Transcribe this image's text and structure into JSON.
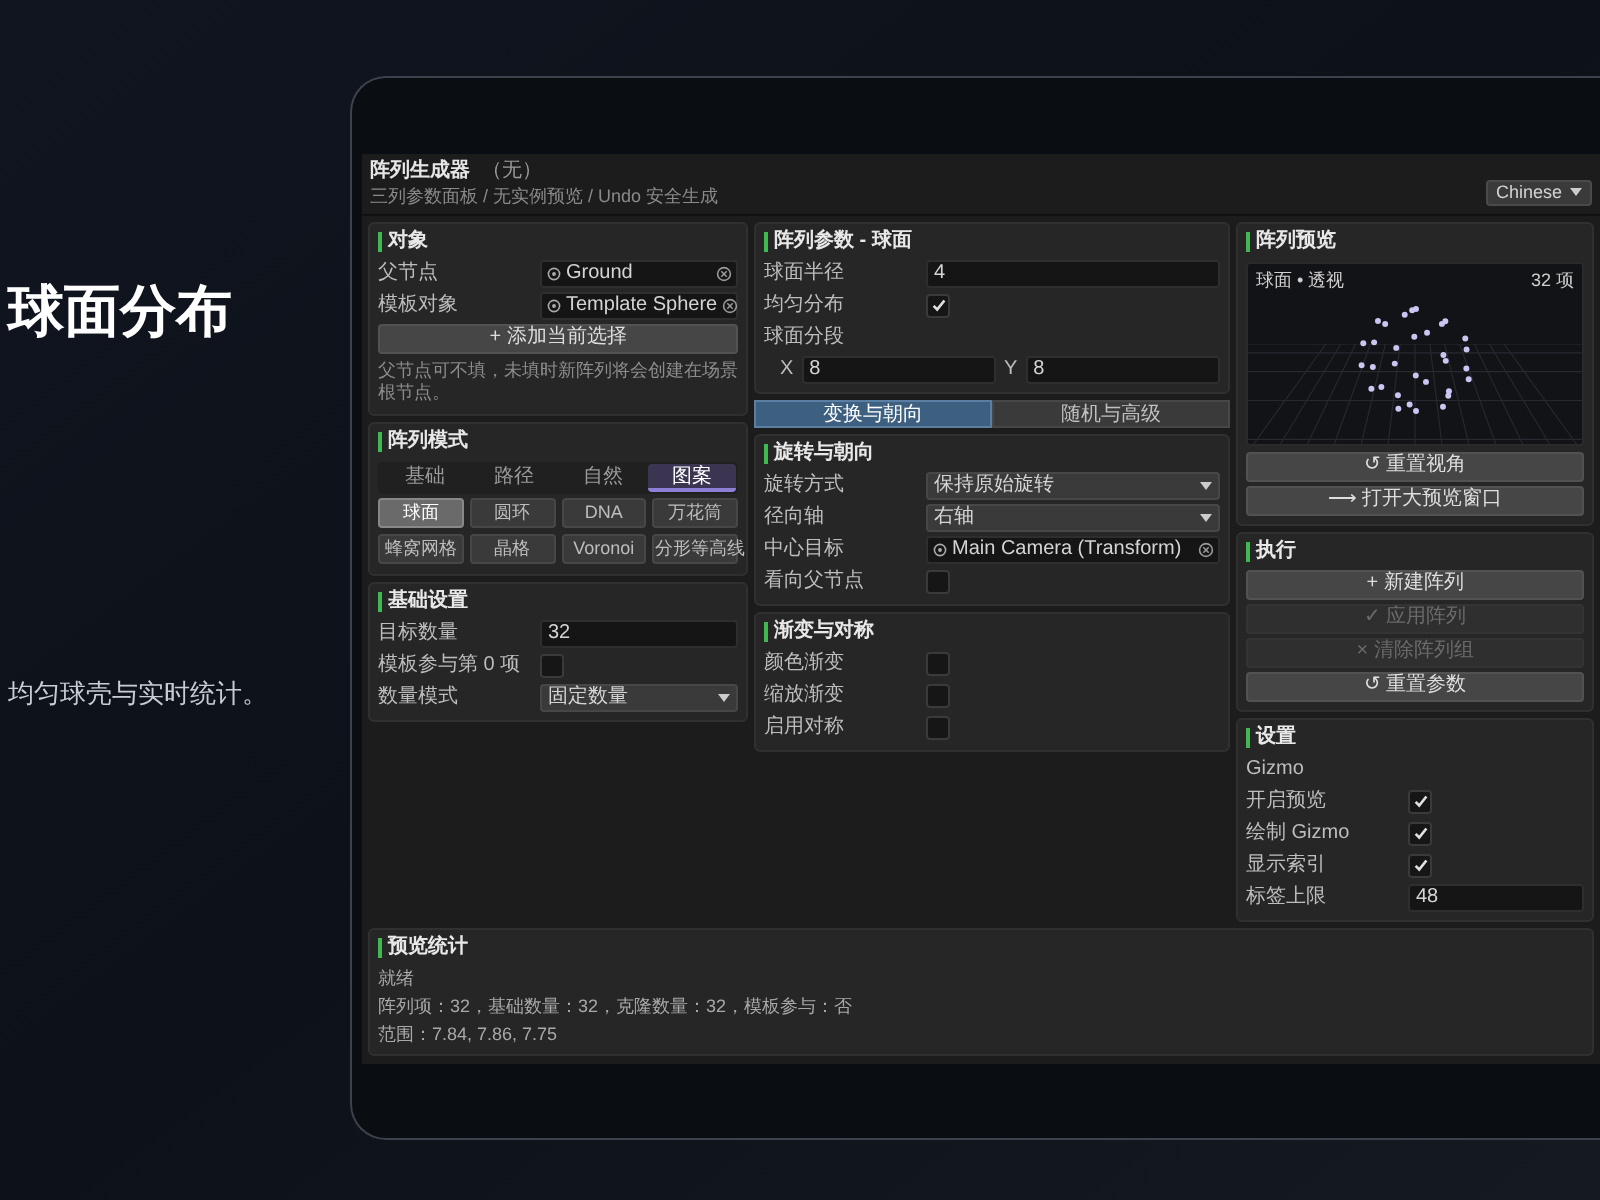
{
  "slide": {
    "title": "球面分布",
    "subtitle": "均匀球壳与实时统计。"
  },
  "window": {
    "title": "阵列生成器",
    "title_note": "（无）",
    "subtitle": "三列参数面板 / 无实例预览 / Undo 安全生成",
    "language": "Chinese"
  },
  "columns": [
    [
      {
        "kind": "panel",
        "title": "对象",
        "items": [
          {
            "kind": "object",
            "label": "父节点",
            "value": "Ground"
          },
          {
            "kind": "object",
            "label": "模板对象",
            "value": "Template Sphere"
          },
          {
            "kind": "button",
            "label": "+ 添加当前选择",
            "disabled": false
          },
          {
            "kind": "note",
            "text": "父节点可不填，未填时新阵列将会创建在场景根节点。"
          }
        ]
      },
      {
        "kind": "panel",
        "title": "阵列模式",
        "items": [
          {
            "kind": "tabs",
            "tabs": [
              {
                "label": "基础",
                "selected": false
              },
              {
                "label": "路径",
                "selected": false
              },
              {
                "label": "自然",
                "selected": false
              },
              {
                "label": "图案",
                "selected": true
              }
            ]
          },
          {
            "kind": "choices",
            "choices": [
              {
                "label": "球面",
                "selected": true
              },
              {
                "label": "圆环",
                "selected": false
              },
              {
                "label": "DNA",
                "selected": false
              },
              {
                "label": "万花筒",
                "selected": false
              },
              {
                "label": "蜂窝网格",
                "selected": false
              },
              {
                "label": "晶格",
                "selected": false
              },
              {
                "label": "Voronoi",
                "selected": false
              },
              {
                "label": "分形等高线",
                "selected": false
              }
            ]
          }
        ]
      },
      {
        "kind": "panel",
        "title": "基础设置",
        "items": [
          {
            "kind": "field",
            "label": "目标数量",
            "value": "32"
          },
          {
            "kind": "check",
            "label": "模板参与第 0 项",
            "checked": false
          },
          {
            "kind": "dropdown",
            "label": "数量模式",
            "value": "固定数量"
          }
        ]
      }
    ],
    [
      {
        "kind": "panel",
        "title": "阵列参数 - 球面",
        "items": [
          {
            "kind": "field",
            "label": "球面半径",
            "value": "4"
          },
          {
            "kind": "check",
            "label": "均匀分布",
            "checked": true
          },
          {
            "kind": "label",
            "text": "球面分段"
          },
          {
            "kind": "vector",
            "parts": [
              {
                "axis": "X",
                "value": "8"
              },
              {
                "axis": "Y",
                "value": "8"
              }
            ]
          }
        ]
      },
      {
        "kind": "tabs",
        "tabs": [
          {
            "label": "变换与朝向",
            "selected": true
          },
          {
            "label": "随机与高级",
            "selected": false
          }
        ]
      },
      {
        "kind": "panel",
        "title": "旋转与朝向",
        "items": [
          {
            "kind": "dropdown",
            "label": "旋转方式",
            "value": "保持原始旋转"
          },
          {
            "kind": "dropdown",
            "label": "径向轴",
            "value": "右轴"
          },
          {
            "kind": "object",
            "label": "中心目标",
            "value": "Main Camera (Transform)"
          },
          {
            "kind": "check",
            "label": "看向父节点",
            "checked": false
          }
        ]
      },
      {
        "kind": "panel",
        "title": "渐变与对称",
        "items": [
          {
            "kind": "check",
            "label": "颜色渐变",
            "checked": false
          },
          {
            "kind": "check",
            "label": "缩放渐变",
            "checked": false
          },
          {
            "kind": "check",
            "label": "启用对称",
            "checked": false
          }
        ]
      }
    ],
    [
      {
        "kind": "panel",
        "title": "阵列预览",
        "items": [
          {
            "kind": "preview",
            "label": "球面 • 透视",
            "count": "32 项"
          },
          {
            "kind": "button",
            "label": "↺ 重置视角",
            "disabled": false
          },
          {
            "kind": "button",
            "label": "⟶ 打开大预览窗口",
            "disabled": false
          }
        ]
      },
      {
        "kind": "panel",
        "title": "执行",
        "items": [
          {
            "kind": "button",
            "label": "+ 新建阵列",
            "disabled": false
          },
          {
            "kind": "button",
            "label": "✓ 应用阵列",
            "disabled": true
          },
          {
            "kind": "button",
            "label": "× 清除阵列组",
            "disabled": true
          },
          {
            "kind": "button",
            "label": "↺ 重置参数",
            "disabled": false
          }
        ]
      },
      {
        "kind": "panel",
        "title": "设置",
        "items": [
          {
            "kind": "label",
            "text": "Gizmo"
          },
          {
            "kind": "check",
            "label": "开启预览",
            "checked": true
          },
          {
            "kind": "check",
            "label": "绘制 Gizmo",
            "checked": true
          },
          {
            "kind": "check",
            "label": "显示索引",
            "checked": true
          },
          {
            "kind": "field",
            "label": "标签上限",
            "value": "48"
          }
        ]
      }
    ]
  ],
  "stats": {
    "title": "预览统计",
    "lines": [
      "就绪",
      "阵列项：32，基础数量：32，克隆数量：32，模板参与：否",
      "范围：7.84, 7.86, 7.75"
    ]
  }
}
